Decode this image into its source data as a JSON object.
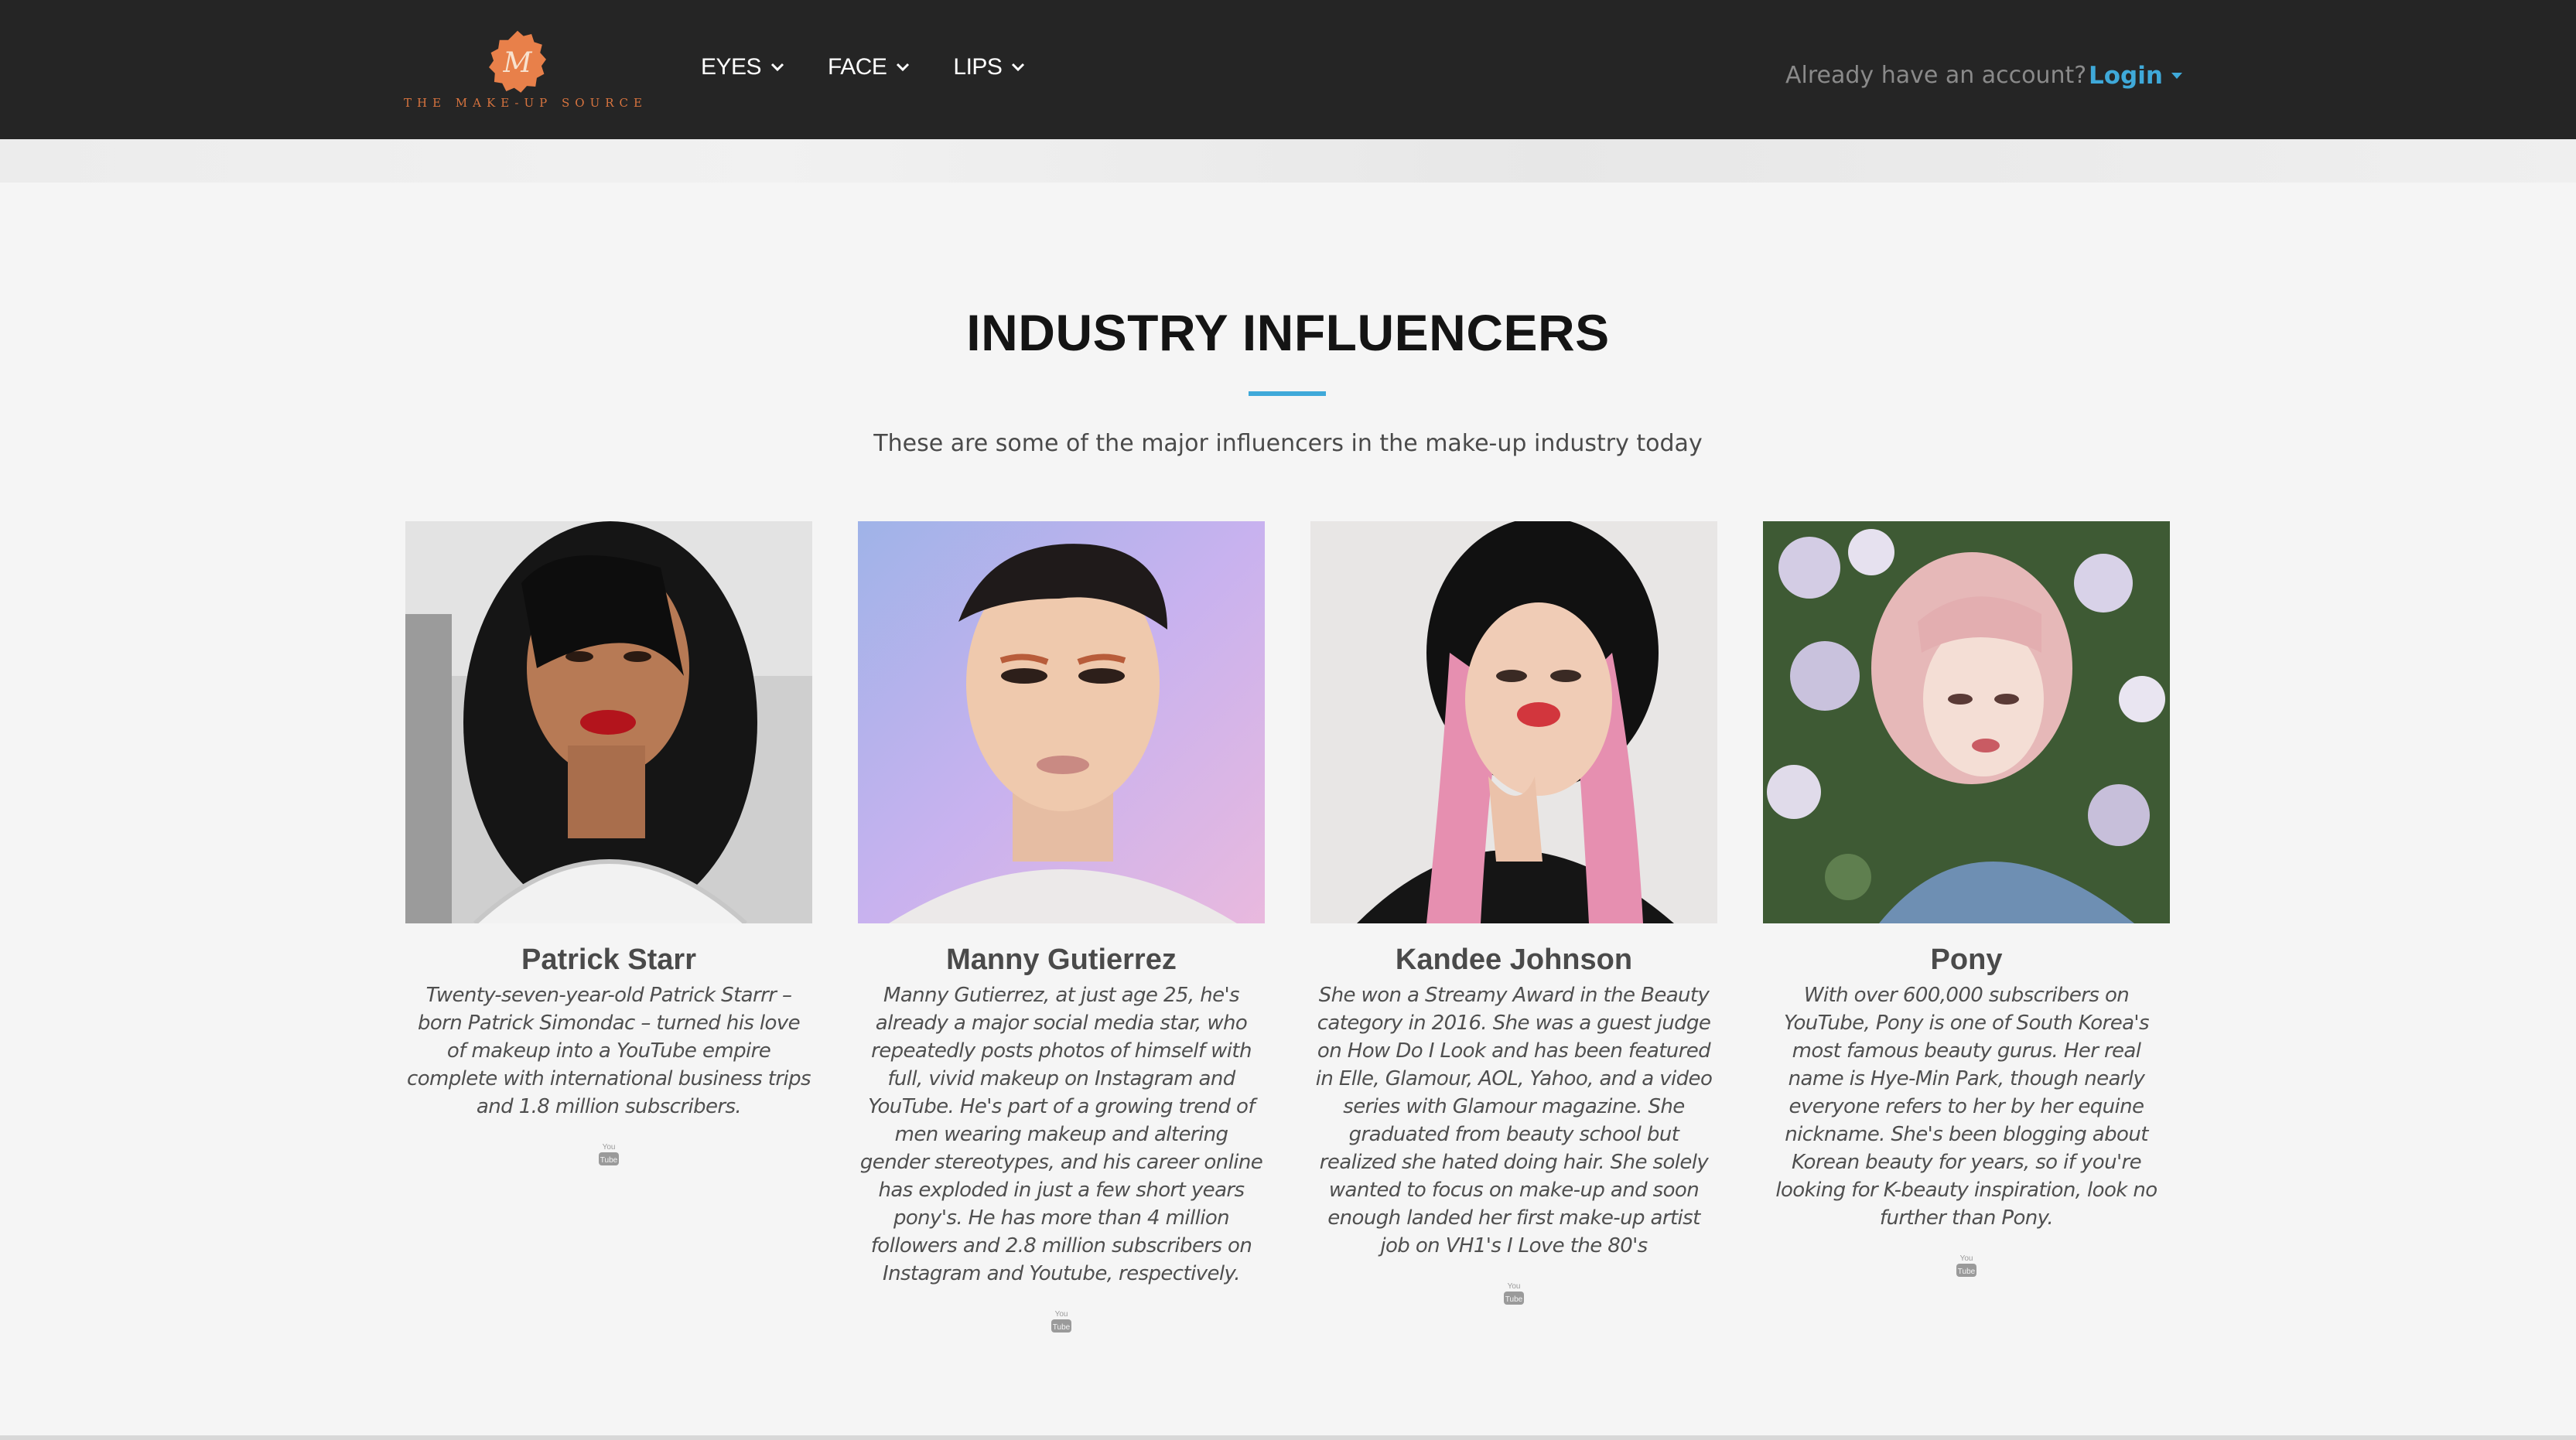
{
  "brand": {
    "logo_text": "THE MAKE-UP SOURCE",
    "logo_monogram": "M",
    "logo_color": "#e8804a"
  },
  "nav": {
    "items": [
      {
        "label": "EYES",
        "icon": "chevron-down-icon"
      },
      {
        "label": "FACE",
        "icon": "chevron-down-icon"
      },
      {
        "label": "LIPS",
        "icon": "chevron-down-icon"
      }
    ],
    "account_prompt": "Already have an account?",
    "login_label": "Login"
  },
  "section": {
    "title": "INDUSTRY INFLUENCERS",
    "subtitle": "These are some of the major influencers in the make-up industry today",
    "accent_color": "#3fa9d9"
  },
  "influencers": [
    {
      "name": "Patrick Starr",
      "bio": "Twenty-seven-year-old Patrick Starrr – born Patrick Simondac – turned his love of makeup into a YouTube empire complete with international business trips and 1.8 million subscribers.",
      "social_icon": "youtube-icon"
    },
    {
      "name": "Manny Gutierrez",
      "bio": "Manny Gutierrez, at just age 25, he's already a major social media star, who repeatedly posts photos of himself with full, vivid makeup on Instagram and YouTube. He's part of a growing trend of men wearing makeup and altering gender stereotypes, and his career online has exploded in just a few short years pony's. He has more than 4 million followers and 2.8 million subscribers on Instagram and Youtube, respectively.",
      "social_icon": "youtube-icon"
    },
    {
      "name": "Kandee Johnson",
      "bio": "She won a Streamy Award in the Beauty category in 2016. She was a guest judge on How Do I Look and has been featured in Elle, Glamour, AOL, Yahoo, and a video series with Glamour magazine. She graduated from beauty school but realized she hated doing hair. She solely wanted to focus on make-up and soon enough landed her first make-up artist job on VH1's I Love the 80's",
      "social_icon": "youtube-icon"
    },
    {
      "name": "Pony",
      "bio": "With over 600,000 subscribers on YouTube, Pony is one of South Korea's most famous beauty gurus. Her real name is Hye-Min Park, though nearly everyone refers to her by her equine nickname. She's been blogging about Korean beauty for years, so if you're looking for K-beauty inspiration, look no further than Pony.",
      "social_icon": "youtube-icon"
    }
  ]
}
